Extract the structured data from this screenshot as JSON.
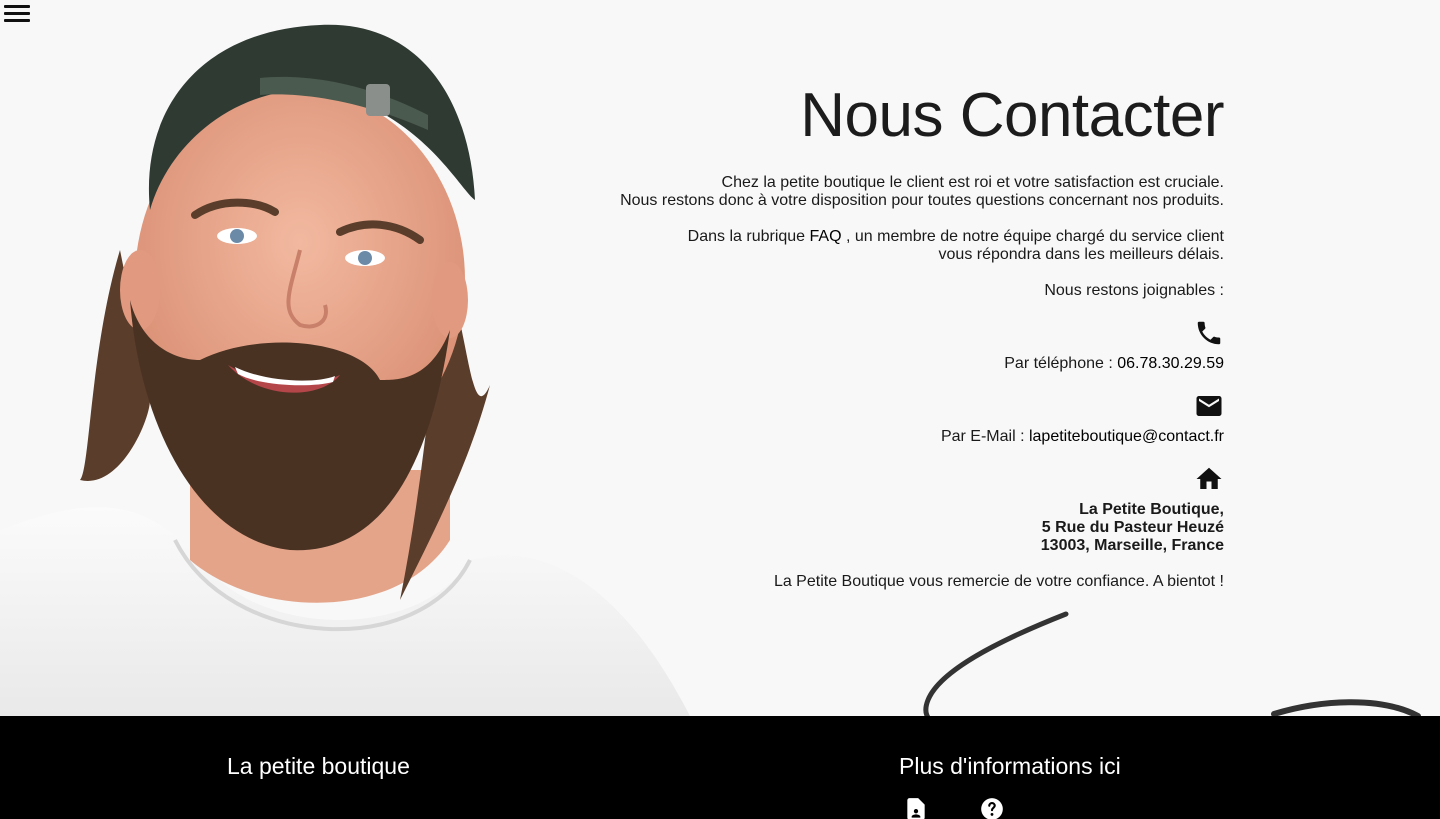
{
  "nav": {
    "menu_icon": "hamburger-menu-icon"
  },
  "hero": {
    "title": "Nous Contacter",
    "intro_line1": "Chez la petite boutique le client est roi et votre satisfaction est cruciale.",
    "intro_line2": "Nous restons donc à votre disposition pour toutes questions concernant nos produits.",
    "faq_prefix": "Dans la rubrique",
    "faq_link": "FAQ",
    "faq_suffix": ", un membre de notre équipe chargé du service client",
    "faq_line2": "vous répondra dans les meilleurs délais.",
    "reach_text": "Nous restons joignables :",
    "phone": {
      "icon": "phone-icon",
      "label": "Par téléphone :",
      "value": "06.78.30.29.59"
    },
    "email": {
      "icon": "mail-icon",
      "label": "Par E-Mail :",
      "value": "lapetiteboutique@contact.fr"
    },
    "address": {
      "icon": "home-icon",
      "line1": "La Petite Boutique,",
      "line2": "5 Rue du Pasteur Heuzé",
      "line3": "13003, Marseille, France"
    },
    "thanks": "La Petite Boutique vous remercie de votre confiance. A bientot !"
  },
  "footer": {
    "left_title": "La petite boutique",
    "right_title": "Plus d'informations ici",
    "icons": [
      "contact-file-icon",
      "help-circle-icon"
    ]
  }
}
